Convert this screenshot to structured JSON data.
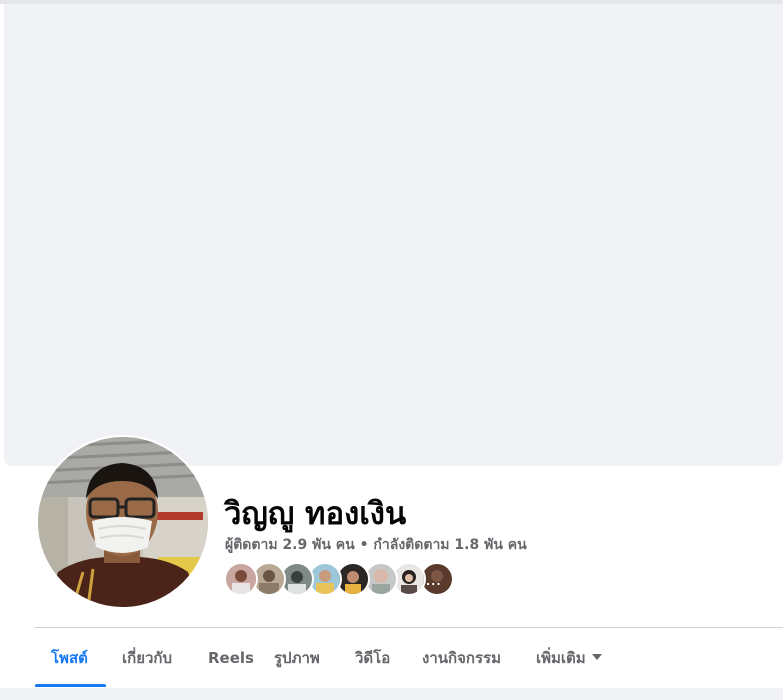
{
  "profile": {
    "name": "วิญญู ทองเงิน",
    "followers_text": "ผู้ติดตาม 2.9 พัน คน • กำลังติดตาม 1.8 พัน คน"
  },
  "friends": {
    "count_shown": 8,
    "more_indicator": "..."
  },
  "tabs": [
    {
      "label": "โพสต์",
      "active": true
    },
    {
      "label": "เกี่ยวกับ",
      "active": false
    },
    {
      "label": "Reels",
      "active": false
    },
    {
      "label": "รูปภาพ",
      "active": false
    },
    {
      "label": "วิดีโอ",
      "active": false
    },
    {
      "label": "งานกิจกรรม",
      "active": false
    },
    {
      "label": "เพิ่มเติม",
      "active": false
    }
  ],
  "colors": {
    "accent": "#1877f2",
    "cover": "#f0f2f5",
    "text_primary": "#050505",
    "text_secondary": "#65676b"
  }
}
